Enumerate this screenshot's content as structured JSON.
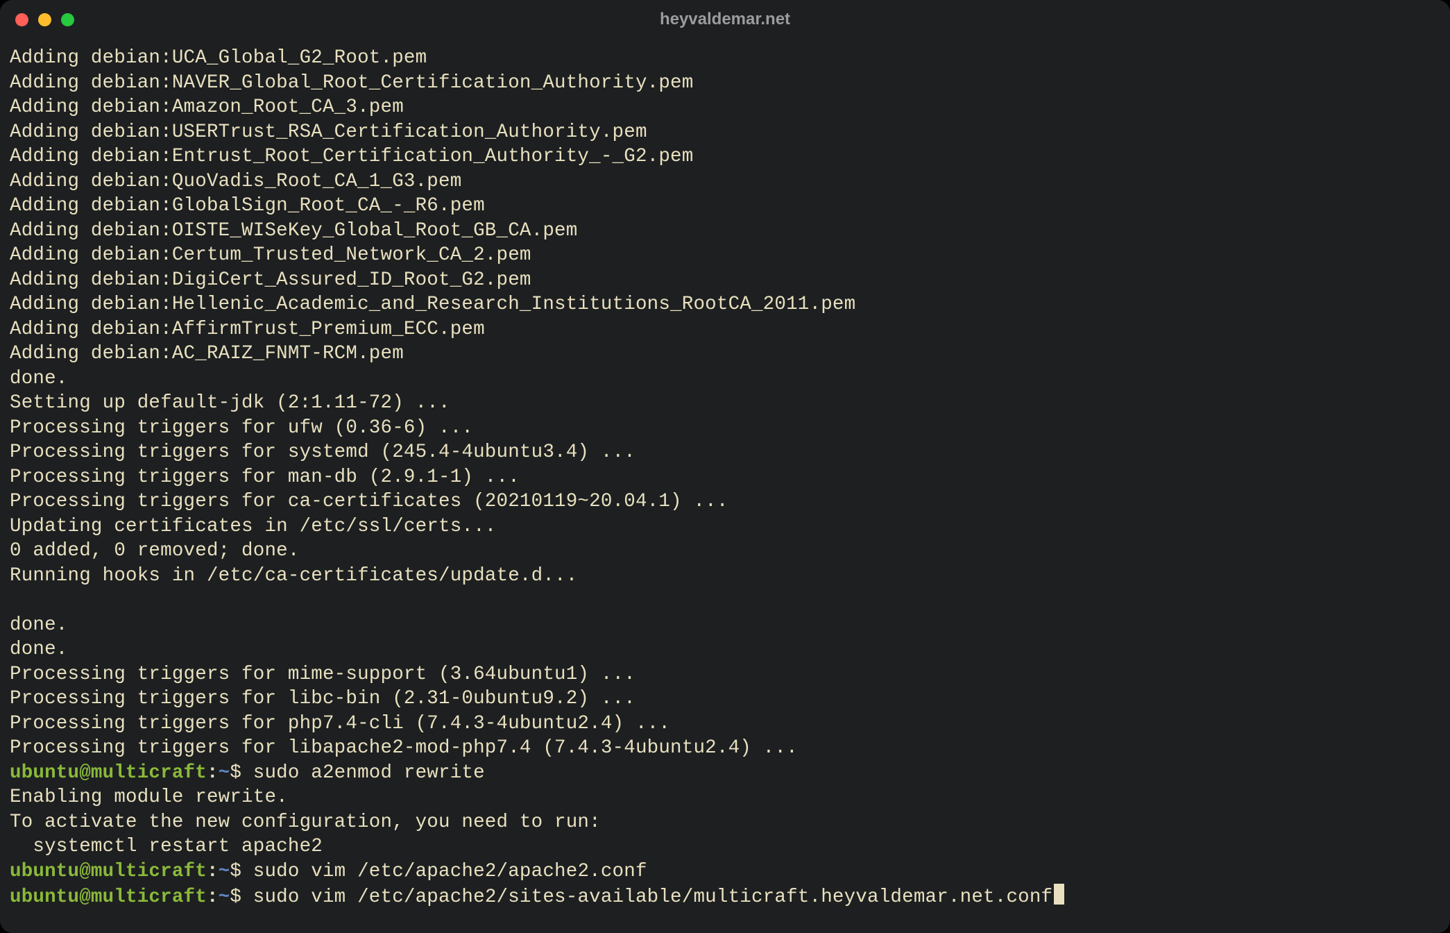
{
  "window": {
    "title": "heyvaldemar.net"
  },
  "output_lines": [
    "Adding debian:UCA_Global_G2_Root.pem",
    "Adding debian:NAVER_Global_Root_Certification_Authority.pem",
    "Adding debian:Amazon_Root_CA_3.pem",
    "Adding debian:USERTrust_RSA_Certification_Authority.pem",
    "Adding debian:Entrust_Root_Certification_Authority_-_G2.pem",
    "Adding debian:QuoVadis_Root_CA_1_G3.pem",
    "Adding debian:GlobalSign_Root_CA_-_R6.pem",
    "Adding debian:OISTE_WISeKey_Global_Root_GB_CA.pem",
    "Adding debian:Certum_Trusted_Network_CA_2.pem",
    "Adding debian:DigiCert_Assured_ID_Root_G2.pem",
    "Adding debian:Hellenic_Academic_and_Research_Institutions_RootCA_2011.pem",
    "Adding debian:AffirmTrust_Premium_ECC.pem",
    "Adding debian:AC_RAIZ_FNMT-RCM.pem",
    "done.",
    "Setting up default-jdk (2:1.11-72) ...",
    "Processing triggers for ufw (0.36-6) ...",
    "Processing triggers for systemd (245.4-4ubuntu3.4) ...",
    "Processing triggers for man-db (2.9.1-1) ...",
    "Processing triggers for ca-certificates (20210119~20.04.1) ...",
    "Updating certificates in /etc/ssl/certs...",
    "0 added, 0 removed; done.",
    "Running hooks in /etc/ca-certificates/update.d...",
    "",
    "done.",
    "done.",
    "Processing triggers for mime-support (3.64ubuntu1) ...",
    "Processing triggers for libc-bin (2.31-0ubuntu9.2) ...",
    "Processing triggers for php7.4-cli (7.4.3-4ubuntu2.4) ...",
    "Processing triggers for libapache2-mod-php7.4 (7.4.3-4ubuntu2.4) ..."
  ],
  "prompts": [
    {
      "user": "ubuntu@multicraft",
      "sep": ":",
      "path": "~",
      "dollar": "$ ",
      "command": "sudo a2enmod rewrite",
      "after": [
        "Enabling module rewrite.",
        "To activate the new configuration, you need to run:",
        "  systemctl restart apache2"
      ],
      "cursor": false
    },
    {
      "user": "ubuntu@multicraft",
      "sep": ":",
      "path": "~",
      "dollar": "$ ",
      "command": "sudo vim /etc/apache2/apache2.conf",
      "after": [],
      "cursor": false
    },
    {
      "user": "ubuntu@multicraft",
      "sep": ":",
      "path": "~",
      "dollar": "$ ",
      "command": "sudo vim /etc/apache2/sites-available/multicraft.heyvaldemar.net.conf",
      "after": [],
      "cursor": true
    }
  ]
}
